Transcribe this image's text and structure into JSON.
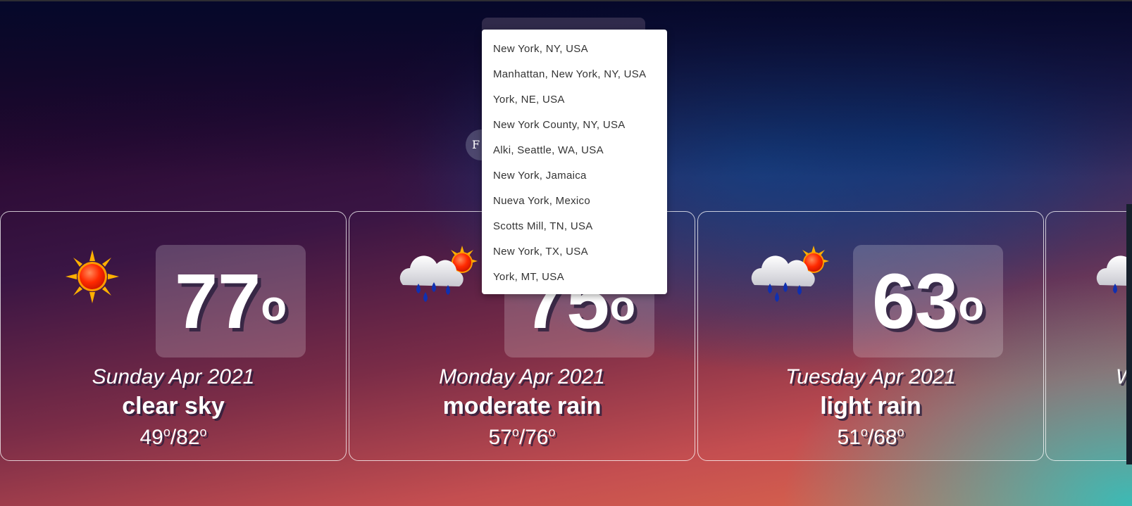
{
  "search": {
    "toggle_label": "F"
  },
  "suggestions": [
    "New York, NY, USA",
    "Manhattan, New York, NY, USA",
    "York, NE, USA",
    "New York County, NY, USA",
    "Alki, Seattle, WA, USA",
    "New York, Jamaica",
    "Nueva York, Mexico",
    "Scotts Mill, TN, USA",
    "New York, TX, USA",
    "York, MT, USA"
  ],
  "forecast": [
    {
      "day": "Sunday Apr 2021",
      "temp": "77",
      "degree": "o",
      "description": "clear sky",
      "range": "49o/82o",
      "icon": "sun-icon"
    },
    {
      "day": "Monday Apr 2021",
      "temp": "75",
      "degree": "o",
      "description": "moderate rain",
      "range": "57o/76o",
      "icon": "rain-cloud-sun-icon"
    },
    {
      "day": "Tuesday Apr 2021",
      "temp": "63",
      "degree": "o",
      "description": "light rain",
      "range": "51o/68o",
      "icon": "rain-cloud-sun-icon"
    },
    {
      "day": "W",
      "icon": "rain-cloud-sun-icon"
    }
  ],
  "colors": {
    "dropdown_bg": "#ffffff",
    "dropdown_text": "#333333",
    "card_border": "#ffffff"
  }
}
